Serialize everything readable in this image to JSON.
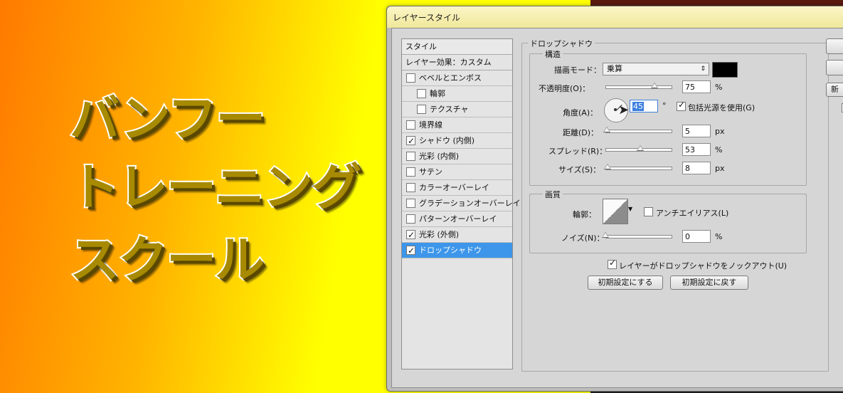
{
  "poster": {
    "line1": "バンフー",
    "line2": "トレーニング",
    "line3": "スクール"
  },
  "dialog": {
    "title": "レイヤースタイル",
    "style_list": {
      "header": "スタイル",
      "subheader": "レイヤー効果：カスタム",
      "items": [
        {
          "label": "ベベルとエンボス",
          "checked": false,
          "indent": false
        },
        {
          "label": "輪郭",
          "checked": false,
          "indent": true
        },
        {
          "label": "テクスチャ",
          "checked": false,
          "indent": true
        },
        {
          "label": "境界線",
          "checked": false,
          "indent": false
        },
        {
          "label": "シャドウ (内側)",
          "checked": true,
          "indent": false
        },
        {
          "label": "光彩 (内側)",
          "checked": false,
          "indent": false
        },
        {
          "label": "サテン",
          "checked": false,
          "indent": false
        },
        {
          "label": "カラーオーバーレイ",
          "checked": false,
          "indent": false
        },
        {
          "label": "グラデーションオーバーレイ",
          "checked": false,
          "indent": false
        },
        {
          "label": "パターンオーバーレイ",
          "checked": false,
          "indent": false
        },
        {
          "label": "光彩 (外側)",
          "checked": true,
          "indent": false
        },
        {
          "label": "ドロップシャドウ",
          "checked": true,
          "indent": false,
          "selected": true
        }
      ]
    },
    "drop_shadow": {
      "group_title": "ドロップシャドウ",
      "structure": {
        "title": "構造",
        "blend_mode_label": "描画モード：",
        "blend_mode_value": "乗算",
        "swatch_color": "#000000",
        "opacity_label": "不透明度(O)：",
        "opacity_value": "75",
        "opacity_unit": "%",
        "opacity_fraction": 0.75,
        "angle_label": "角度(A)：",
        "angle_value": "45",
        "angle_unit": "°",
        "global_light_label": "包括光源を使用(G)",
        "global_light_checked": true,
        "distance_label": "距離(D)：",
        "distance_value": "5",
        "distance_unit": "px",
        "distance_fraction": 0.02,
        "spread_label": "スプレッド(R)：",
        "spread_value": "53",
        "spread_unit": "%",
        "spread_fraction": 0.53,
        "size_label": "サイズ(S)：",
        "size_value": "8",
        "size_unit": "px",
        "size_fraction": 0.03
      },
      "quality": {
        "title": "画質",
        "contour_label": "輪郭：",
        "antialias_label": "アンチエイリアス(L)",
        "antialias_checked": false,
        "noise_label": "ノイズ(N)：",
        "noise_value": "0",
        "noise_unit": "%",
        "noise_fraction": 0.0
      },
      "knockout_label": "レイヤーがドロップシャドウをノックアウト(U)",
      "knockout_checked": true,
      "make_default_label": "初期設定にする",
      "reset_default_label": "初期設定に戻す"
    },
    "side_buttons": {
      "new_label": "新"
    }
  }
}
